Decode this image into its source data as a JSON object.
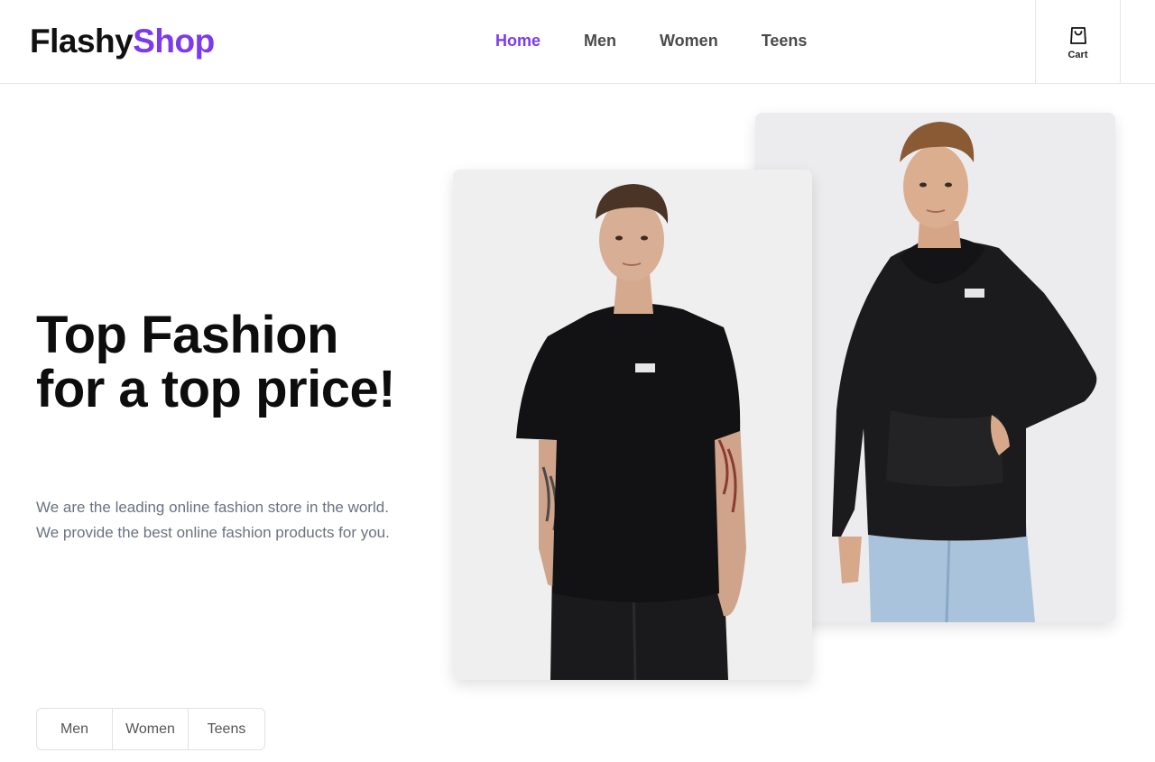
{
  "brand": {
    "part1": "Flashy",
    "part2": "Shop"
  },
  "nav": {
    "items": [
      {
        "label": "Home",
        "active": true
      },
      {
        "label": "Men",
        "active": false
      },
      {
        "label": "Women",
        "active": false
      },
      {
        "label": "Teens",
        "active": false
      }
    ]
  },
  "cart": {
    "label": "Cart",
    "icon": "shopping-bag-icon"
  },
  "hero": {
    "title": "Top Fashion for a top price!",
    "subtitle": "We are the leading online fashion store in the world. We provide the best online fashion products for you."
  },
  "categories": [
    "Men",
    "Women",
    "Teens"
  ],
  "images": [
    {
      "name": "model-in-black-hoodie"
    },
    {
      "name": "model-in-black-tshirt"
    }
  ],
  "colors": {
    "accent": "#7c3aed",
    "text": "#111111",
    "muted": "#6b7280"
  }
}
